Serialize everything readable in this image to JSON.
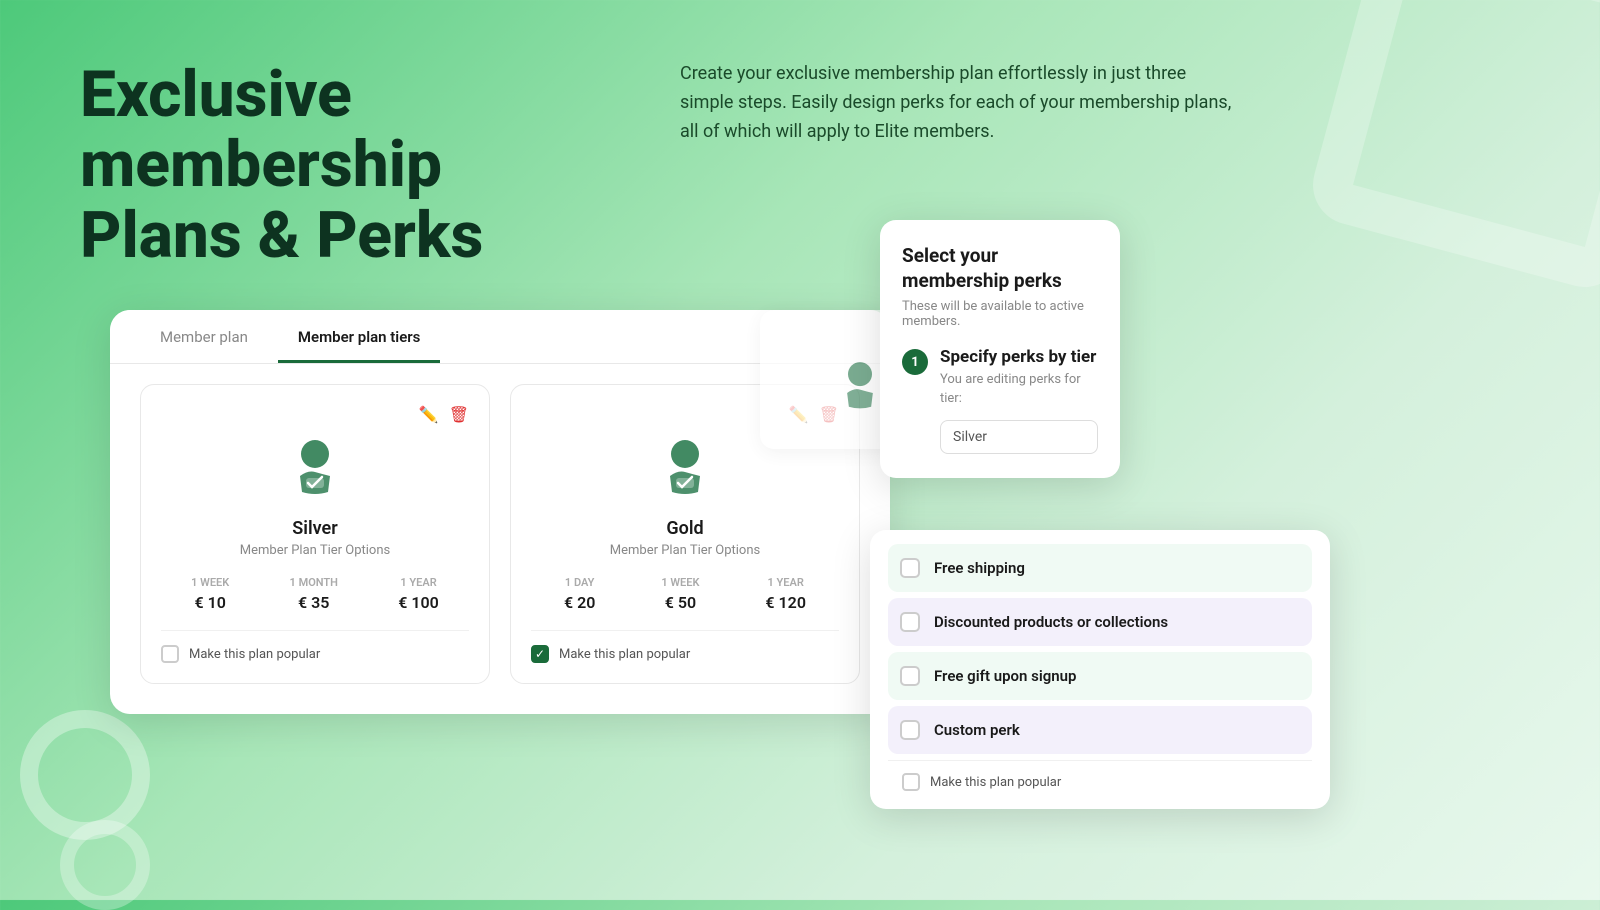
{
  "page": {
    "title": "Exclusive membership Plans & Perks",
    "description": "Create your exclusive membership plan effortlessly in just three simple steps. Easily design perks for each of your membership plans, all of which will apply to Elite members."
  },
  "tabs": {
    "tab1": "Member plan",
    "tab2": "Member plan tiers"
  },
  "tiers": [
    {
      "name": "Silver",
      "subtitle": "Member Plan Tier Options",
      "pricing": [
        {
          "label": "1 WEEK",
          "value": "€ 10"
        },
        {
          "label": "1 MONTH",
          "value": "€ 35"
        },
        {
          "label": "1 YEAR",
          "value": "€ 100"
        }
      ],
      "popular": false,
      "popular_label": "Make this plan popular"
    },
    {
      "name": "Gold",
      "subtitle": "Member Plan Tier Options",
      "pricing": [
        {
          "label": "1 DAY",
          "value": "€ 20"
        },
        {
          "label": "1 WEEK",
          "value": "€ 50"
        },
        {
          "label": "1 YEAR",
          "value": "€ 120"
        }
      ],
      "popular": true,
      "popular_label": "Make this plan popular"
    }
  ],
  "perks_select": {
    "title": "Select your membership perks",
    "subtitle": "These will be available to active members.",
    "step_number": "1",
    "specify_title": "Specify perks by tier",
    "specify_description": "You are editing perks for tier:",
    "tier_value": "Silver"
  },
  "perks_list": [
    {
      "label": "Free shipping",
      "checked": false,
      "style": "green"
    },
    {
      "label": "Discounted products or collections",
      "checked": false,
      "style": "purple"
    },
    {
      "label": "Free gift upon signup",
      "checked": false,
      "style": "green"
    },
    {
      "label": "Custom perk",
      "checked": false,
      "style": "purple"
    }
  ],
  "perks_bottom": {
    "popular_label": "Make this plan popular"
  }
}
